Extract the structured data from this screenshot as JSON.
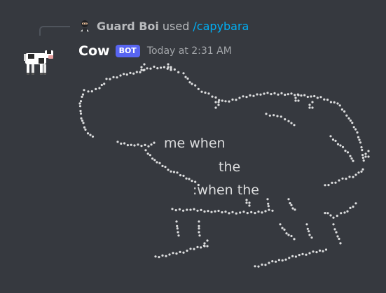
{
  "command": {
    "user": "Guard Boi",
    "used_text": "used",
    "command_name": "/capybara",
    "avatar_icon": "ninja-avatar-icon"
  },
  "message": {
    "username": "Cow",
    "bot_tag": "BOT",
    "timestamp": "Today at 2:31 AM",
    "avatar_icon": "cow-avatar-icon",
    "art_lines": [
      "me when",
      "the",
      ":when the"
    ]
  },
  "colors": {
    "background": "#36393f",
    "link": "#00aff4",
    "bot_tag": "#5865f2",
    "text": "#dcddde"
  }
}
